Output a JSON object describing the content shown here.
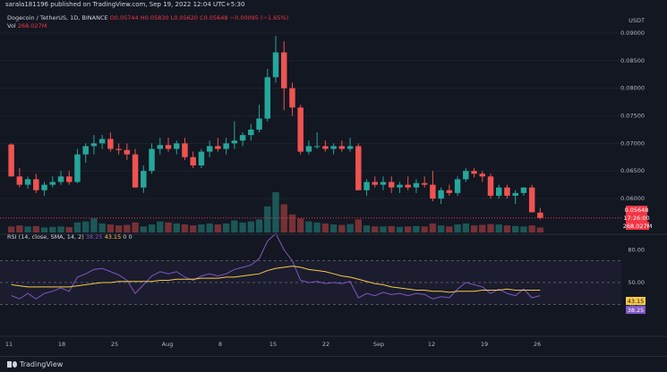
{
  "header": {
    "published": "sarala181196 published on TradingView.com, Sep 19, 2022 12:04 UTC+5:30"
  },
  "legend": {
    "symbol": "Dogecoin / TetherUS, 1D, BINANCE",
    "ohlc": "O0.05744  H0.05830  L0.05620  C0.05648  −0.00095 (−1.65%)",
    "volume_label": "Vol",
    "volume_value": "268.027M"
  },
  "price_axis": {
    "currency": "USDT",
    "ticks": [
      "0.09000",
      "0.08500",
      "0.08000",
      "0.07500",
      "0.07000",
      "0.06500",
      "0.06000"
    ],
    "last_price": "0.05648",
    "countdown": "17:26:00",
    "last_volume": "268.027M",
    "last_price_color": "#f23645"
  },
  "rsi": {
    "legend_label": "RSI (14, close, SMA, 14, 2)",
    "rsi_value": "38.25",
    "sma_value": "43.15",
    "legend_tail": "0  0",
    "ticks": [
      "80.00",
      "50.00",
      "30.00"
    ],
    "rsi_color": "#7e57c2",
    "sma_color": "#f7c948"
  },
  "time_axis": {
    "labels": [
      "11",
      "18",
      "25",
      "Aug",
      "8",
      "15",
      "22",
      "Sep",
      "12",
      "19",
      "26"
    ]
  },
  "footer": {
    "brand": "TradingView"
  },
  "colors": {
    "up": "#26a69a",
    "down": "#ef5350",
    "background": "#131722"
  },
  "chart_data": {
    "type": "candlestick",
    "series": [
      {
        "name": "price",
        "ohlc": [
          [
            0.0698,
            0.07,
            0.064,
            0.064
          ],
          [
            0.064,
            0.0655,
            0.062,
            0.0625
          ],
          [
            0.0625,
            0.064,
            0.0618,
            0.0635
          ],
          [
            0.0635,
            0.0645,
            0.061,
            0.0615
          ],
          [
            0.0615,
            0.063,
            0.0605,
            0.0625
          ],
          [
            0.0625,
            0.064,
            0.062,
            0.063
          ],
          [
            0.063,
            0.065,
            0.0625,
            0.064
          ],
          [
            0.064,
            0.065,
            0.0625,
            0.063
          ],
          [
            0.063,
            0.069,
            0.0628,
            0.068
          ],
          [
            0.068,
            0.07,
            0.0665,
            0.0695
          ],
          [
            0.0695,
            0.0715,
            0.068,
            0.07
          ],
          [
            0.07,
            0.0715,
            0.069,
            0.0708
          ],
          [
            0.0708,
            0.072,
            0.0685,
            0.069
          ],
          [
            0.069,
            0.07,
            0.068,
            0.0688
          ],
          [
            0.0688,
            0.07,
            0.067,
            0.068
          ],
          [
            0.068,
            0.069,
            0.062,
            0.062
          ],
          [
            0.062,
            0.066,
            0.061,
            0.065
          ],
          [
            0.065,
            0.07,
            0.0645,
            0.069
          ],
          [
            0.069,
            0.071,
            0.068,
            0.0697
          ],
          [
            0.0697,
            0.071,
            0.0685,
            0.069
          ],
          [
            0.069,
            0.0705,
            0.068,
            0.07
          ],
          [
            0.07,
            0.071,
            0.067,
            0.0675
          ],
          [
            0.0675,
            0.0685,
            0.0655,
            0.066
          ],
          [
            0.066,
            0.069,
            0.0655,
            0.0685
          ],
          [
            0.0685,
            0.0705,
            0.0675,
            0.0695
          ],
          [
            0.0695,
            0.071,
            0.0685,
            0.069
          ],
          [
            0.069,
            0.071,
            0.068,
            0.07
          ],
          [
            0.07,
            0.074,
            0.069,
            0.0705
          ],
          [
            0.0705,
            0.072,
            0.0695,
            0.0715
          ],
          [
            0.0715,
            0.0735,
            0.0705,
            0.0725
          ],
          [
            0.0725,
            0.077,
            0.072,
            0.0745
          ],
          [
            0.0745,
            0.0835,
            0.074,
            0.082
          ],
          [
            0.082,
            0.0895,
            0.081,
            0.0865
          ],
          [
            0.0865,
            0.0885,
            0.076,
            0.08
          ],
          [
            0.08,
            0.081,
            0.075,
            0.0765
          ],
          [
            0.0765,
            0.077,
            0.068,
            0.0685
          ],
          [
            0.0685,
            0.0705,
            0.068,
            0.0695
          ],
          [
            0.0695,
            0.072,
            0.069,
            0.0695
          ],
          [
            0.0695,
            0.0705,
            0.0685,
            0.069
          ],
          [
            0.069,
            0.07,
            0.068,
            0.0695
          ],
          [
            0.0695,
            0.0705,
            0.0685,
            0.069
          ],
          [
            0.069,
            0.071,
            0.0685,
            0.0695
          ],
          [
            0.0695,
            0.07,
            0.0615,
            0.0615
          ],
          [
            0.0615,
            0.0635,
            0.0605,
            0.063
          ],
          [
            0.063,
            0.064,
            0.062,
            0.0625
          ],
          [
            0.0625,
            0.064,
            0.0615,
            0.063
          ],
          [
            0.063,
            0.064,
            0.061,
            0.062
          ],
          [
            0.062,
            0.063,
            0.061,
            0.0625
          ],
          [
            0.0625,
            0.064,
            0.0615,
            0.062
          ],
          [
            0.062,
            0.0635,
            0.061,
            0.0628
          ],
          [
            0.0628,
            0.064,
            0.062,
            0.0625
          ],
          [
            0.0625,
            0.065,
            0.0595,
            0.06
          ],
          [
            0.06,
            0.062,
            0.059,
            0.0615
          ],
          [
            0.0615,
            0.0625,
            0.0605,
            0.061
          ],
          [
            0.061,
            0.064,
            0.0605,
            0.0635
          ],
          [
            0.0635,
            0.0655,
            0.063,
            0.065
          ],
          [
            0.065,
            0.0655,
            0.0638,
            0.0645
          ],
          [
            0.0645,
            0.065,
            0.063,
            0.064
          ],
          [
            0.064,
            0.0645,
            0.06,
            0.0605
          ],
          [
            0.0605,
            0.0625,
            0.06,
            0.062
          ],
          [
            0.062,
            0.0625,
            0.06,
            0.0605
          ],
          [
            0.0605,
            0.0615,
            0.059,
            0.061
          ],
          [
            0.061,
            0.062,
            0.0605,
            0.062
          ],
          [
            0.062,
            0.0625,
            0.0575,
            0.0575
          ],
          [
            0.05744,
            0.0583,
            0.0562,
            0.05648
          ]
        ]
      },
      {
        "name": "volume",
        "values": [
          0.3,
          0.35,
          0.3,
          0.32,
          0.25,
          0.28,
          0.3,
          0.27,
          0.5,
          0.55,
          0.7,
          0.45,
          0.4,
          0.35,
          0.38,
          0.5,
          0.3,
          0.4,
          0.55,
          0.5,
          0.45,
          0.4,
          0.35,
          0.4,
          0.45,
          0.4,
          0.45,
          0.6,
          0.5,
          0.55,
          0.65,
          1.3,
          2.0,
          1.4,
          0.9,
          0.7,
          0.55,
          0.5,
          0.45,
          0.4,
          0.38,
          0.42,
          0.65,
          0.35,
          0.3,
          0.3,
          0.32,
          0.28,
          0.3,
          0.32,
          0.3,
          0.45,
          0.35,
          0.3,
          0.4,
          0.45,
          0.35,
          0.38,
          0.42,
          0.4,
          0.35,
          0.32,
          0.3,
          0.35,
          0.25
        ]
      },
      {
        "name": "RSI",
        "values": [
          38,
          35,
          40,
          35,
          40,
          42,
          45,
          42,
          55,
          58,
          62,
          63,
          60,
          57,
          52,
          40,
          48,
          56,
          60,
          58,
          60,
          55,
          52,
          56,
          58,
          56,
          58,
          62,
          64,
          66,
          72,
          88,
          95,
          80,
          70,
          52,
          50,
          51,
          49,
          50,
          49,
          51,
          36,
          40,
          38,
          41,
          39,
          40,
          38,
          40,
          39,
          35,
          37,
          36,
          44,
          50,
          48,
          46,
          40,
          44,
          40,
          38,
          44,
          36,
          38
        ]
      },
      {
        "name": "RSI-based MA",
        "values": [
          48,
          47,
          46,
          46,
          46,
          46,
          46,
          46,
          47,
          48,
          49,
          50,
          50,
          51,
          51,
          51,
          51,
          51,
          52,
          52,
          53,
          53,
          53,
          54,
          54,
          54,
          55,
          55,
          56,
          57,
          58,
          61,
          63,
          64,
          65,
          64,
          62,
          61,
          60,
          58,
          56,
          55,
          53,
          51,
          49,
          48,
          46,
          45,
          44,
          43,
          43,
          42,
          42,
          41,
          42,
          42,
          42,
          43,
          43,
          43,
          44,
          43,
          43,
          43,
          43
        ]
      }
    ],
    "rsi_bands": [
      70,
      50,
      30
    ]
  }
}
